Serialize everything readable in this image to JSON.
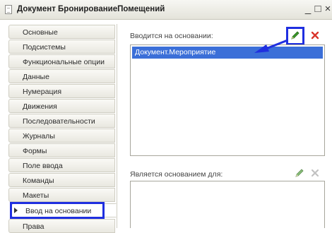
{
  "window": {
    "title": "Документ БронированиеПомещений",
    "minimize": "_",
    "maximize": "□",
    "close": "×"
  },
  "tabs": [
    "Основные",
    "Подсистемы",
    "Функциональные опции",
    "Данные",
    "Нумерация",
    "Движения",
    "Последовательности",
    "Журналы",
    "Формы",
    "Поле ввода",
    "Команды",
    "Макеты",
    "Ввод на основании",
    "Права"
  ],
  "active_tab": "Ввод на основании",
  "based_on": {
    "label": "Вводится на основании:",
    "items": [
      "Документ.Мероприятие"
    ]
  },
  "basis_for": {
    "label": "Является основанием для:",
    "items": []
  },
  "icons": {
    "edit": "pencil-icon",
    "delete": "delete-x-icon",
    "accent": "#1f2fe0",
    "selection": "#3b6fd8"
  }
}
